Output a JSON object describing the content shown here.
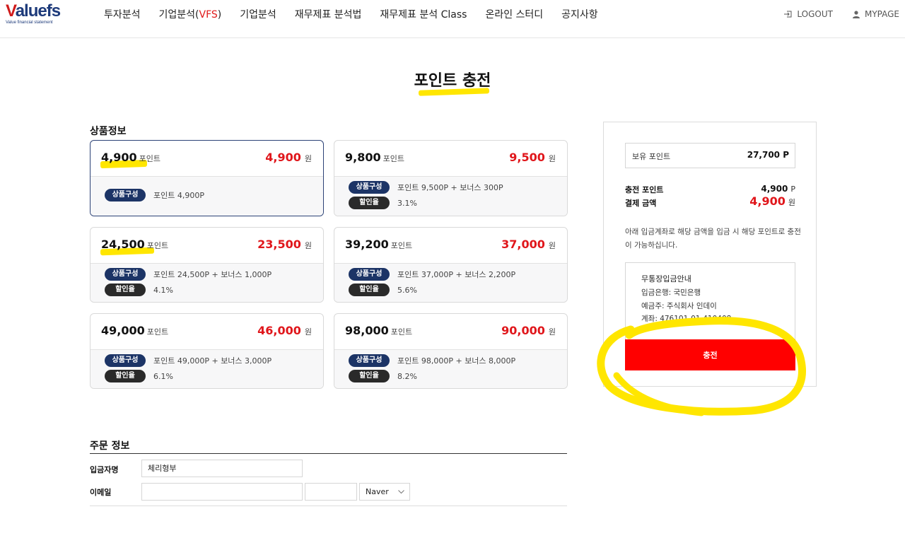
{
  "header": {
    "logo_main_prefix": "V",
    "logo_main_rest": "aluefs",
    "logo_sub": "Value financial statement",
    "nav": [
      {
        "label": "투자분석"
      },
      {
        "label_prefix": "기업분석(",
        "label_vfs": "VFS",
        "label_suffix": ")"
      },
      {
        "label": "기업분석"
      },
      {
        "label": "재무제표 분석법"
      },
      {
        "label": "재무제표 분석 Class"
      },
      {
        "label": "온라인 스터디"
      },
      {
        "label": "공지사항"
      }
    ],
    "logout": "LOGOUT",
    "mypage": "MYPAGE"
  },
  "page": {
    "title": "포인트 충전",
    "product_heading": "상품정보",
    "order_heading": "주문 정보"
  },
  "products": [
    {
      "points": "4,900",
      "point_unit": "포인트",
      "price": "4,900",
      "price_unit": "원",
      "composition_badge": "상품구성",
      "composition": "포인트 4,900P",
      "discount_badge": "",
      "discount": ""
    },
    {
      "points": "9,800",
      "point_unit": "포인트",
      "price": "9,500",
      "price_unit": "원",
      "composition_badge": "상품구성",
      "composition": "포인트 9,500P + 보너스 300P",
      "discount_badge": "할인율",
      "discount": "3.1%"
    },
    {
      "points": "24,500",
      "point_unit": "포인트",
      "price": "23,500",
      "price_unit": "원",
      "composition_badge": "상품구성",
      "composition": "포인트 24,500P + 보너스 1,000P",
      "discount_badge": "할인율",
      "discount": "4.1%"
    },
    {
      "points": "39,200",
      "point_unit": "포인트",
      "price": "37,000",
      "price_unit": "원",
      "composition_badge": "상품구성",
      "composition": "포인트 37,000P + 보너스 2,200P",
      "discount_badge": "할인율",
      "discount": "5.6%"
    },
    {
      "points": "49,000",
      "point_unit": "포인트",
      "price": "46,000",
      "price_unit": "원",
      "composition_badge": "상품구성",
      "composition": "포인트 49,000P + 보너스 3,000P",
      "discount_badge": "할인율",
      "discount": "6.1%"
    },
    {
      "points": "98,000",
      "point_unit": "포인트",
      "price": "90,000",
      "price_unit": "원",
      "composition_badge": "상품구성",
      "composition": "포인트 98,000P + 보너스 8,000P",
      "discount_badge": "할인율",
      "discount": "8.2%"
    }
  ],
  "summary": {
    "owned_label": "보유 포인트",
    "owned_value": "27,700 P",
    "charge_points_label": "충전 포인트",
    "charge_points_value": "4,900",
    "charge_points_unit": "P",
    "pay_label": "결제 금액",
    "pay_value": "4,900",
    "pay_unit": "원",
    "notice": "아래 입금계좌로 해당 금액을 입금 시 해당 포인트로 충전이 가능하십니다.",
    "bank_title": "무통장입금안내",
    "bank_name": "입금은행: 국민은행",
    "account_holder": "예금주: 주식회사 인데이",
    "account_number": "계좌: 476101-01-410408",
    "charge_button": "충전"
  },
  "order": {
    "depositor_label": "입금자명",
    "depositor_value": "체리형부",
    "email_label": "이메일",
    "email_id": "",
    "email_domain": "",
    "email_select": "Naver"
  },
  "colors": {
    "accent_red": "#e0161b",
    "button_red": "#ff0000",
    "badge_navy": "#1c3466",
    "badge_dark": "#2a2a2a",
    "highlight_yellow": "#ffe600"
  }
}
